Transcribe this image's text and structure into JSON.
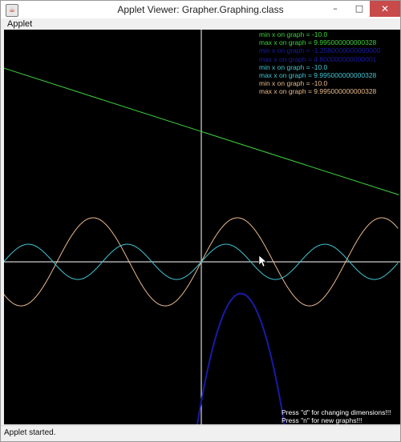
{
  "window": {
    "title": "Applet Viewer: Grapher.Graphing.class",
    "icon": "java-cup-icon",
    "controls": {
      "minimize": "–",
      "maximize": "□",
      "close": "✕"
    }
  },
  "menubar": {
    "applet_label": "Applet"
  },
  "graph": {
    "info_lines": [
      {
        "text": "min x on graph = -10.0",
        "color": "#3cd13c"
      },
      {
        "text": "max x on graph = 9.995000000000328",
        "color": "#3cd13c"
      },
      {
        "text": "min x on graph = -1.2580000000000000",
        "color": "#1a1aa8"
      },
      {
        "text": "max x on graph = 4.800000000000001",
        "color": "#1a1aa8"
      },
      {
        "text": "min x on graph = -10.0",
        "color": "#42c6d4"
      },
      {
        "text": "max x on graph = 9.995000000000328",
        "color": "#42c6d4"
      },
      {
        "text": "min x on graph = -10.0",
        "color": "#e8b98a"
      },
      {
        "text": "max x on graph = 9.995000000000328",
        "color": "#e8b98a"
      }
    ],
    "hints": [
      "Press \"d\" for changing dimensions!!!",
      "Press \"n\" for new graphs!!!"
    ],
    "curve_colors": {
      "linear": "#3cd13c",
      "parabola": "#1a1aa8",
      "sine_small": "#42c6d4",
      "sine_large": "#e8b98a",
      "axes": "#ffffff"
    }
  },
  "chart_data": {
    "type": "line",
    "xlim": [
      -10.0,
      10.0
    ],
    "series": [
      {
        "color": "#3cd13c",
        "kind": "linear",
        "x": [
          -10,
          10
        ],
        "y": [
          11.0,
          3.8
        ]
      },
      {
        "color": "#1a1aa8",
        "kind": "parabola",
        "vertex": [
          2.0,
          -1.8
        ],
        "a": -1.53
      },
      {
        "color": "#42c6d4",
        "kind": "sine",
        "amplitude": 1.0,
        "period": 5.0
      },
      {
        "color": "#e8b98a",
        "kind": "sine",
        "amplitude": 2.5,
        "period": 7.3
      }
    ]
  },
  "status": {
    "text": "Applet started."
  }
}
